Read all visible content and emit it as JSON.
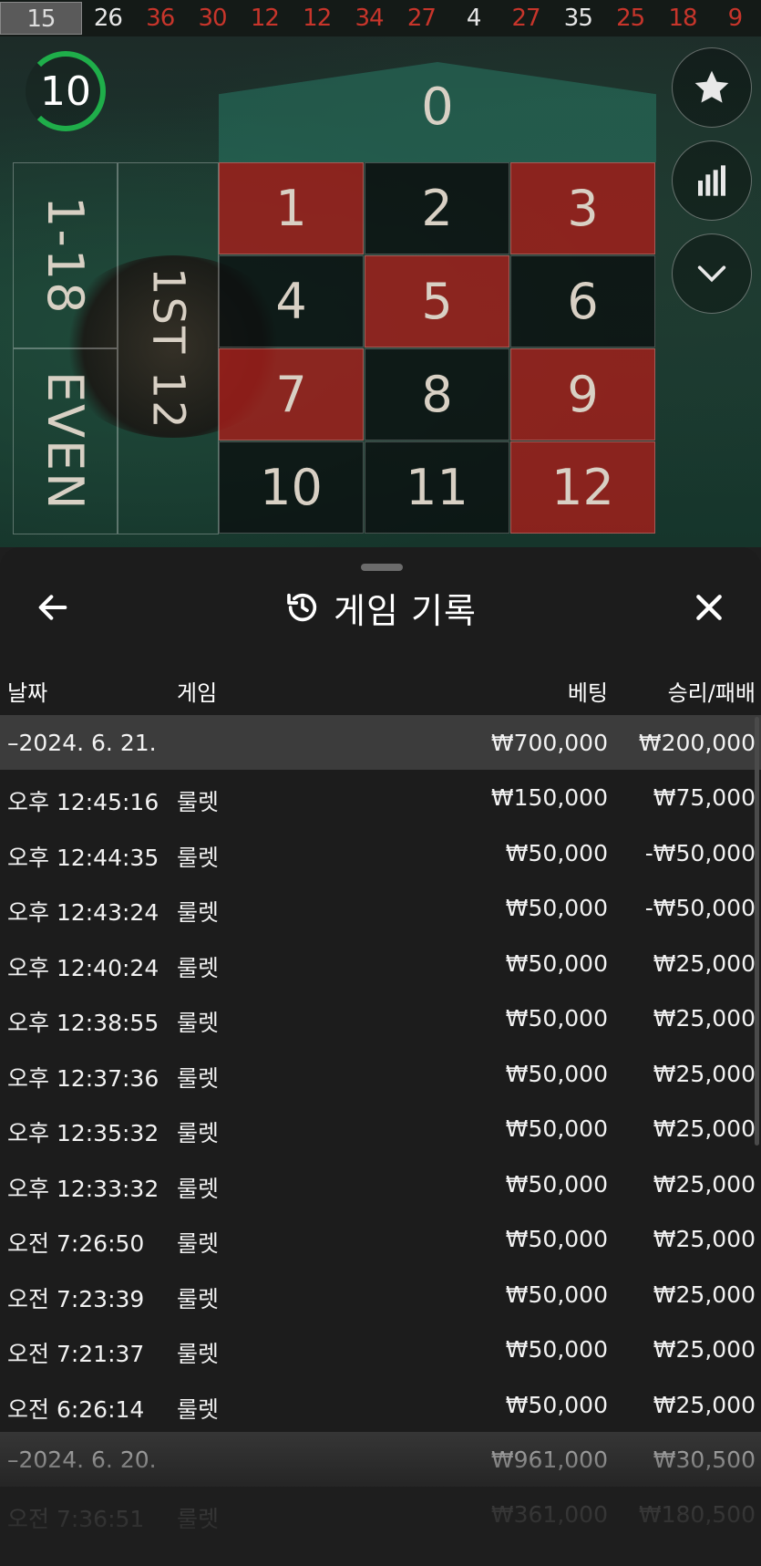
{
  "recent_results": [
    {
      "num": "15",
      "color": "latest"
    },
    {
      "num": "26",
      "color": "black"
    },
    {
      "num": "36",
      "color": "red"
    },
    {
      "num": "30",
      "color": "red"
    },
    {
      "num": "12",
      "color": "red"
    },
    {
      "num": "12",
      "color": "red"
    },
    {
      "num": "34",
      "color": "red"
    },
    {
      "num": "27",
      "color": "red"
    },
    {
      "num": "4",
      "color": "black"
    },
    {
      "num": "27",
      "color": "red"
    },
    {
      "num": "35",
      "color": "black"
    },
    {
      "num": "25",
      "color": "red"
    },
    {
      "num": "18",
      "color": "red"
    },
    {
      "num": "9",
      "color": "red"
    }
  ],
  "timer": "10",
  "board": {
    "zero": "0",
    "cells": [
      {
        "n": "1",
        "c": "red"
      },
      {
        "n": "2",
        "c": "black"
      },
      {
        "n": "3",
        "c": "red"
      },
      {
        "n": "4",
        "c": "black"
      },
      {
        "n": "5",
        "c": "red"
      },
      {
        "n": "6",
        "c": "black"
      },
      {
        "n": "7",
        "c": "red"
      },
      {
        "n": "8",
        "c": "black"
      },
      {
        "n": "9",
        "c": "red"
      },
      {
        "n": "10",
        "c": "black"
      },
      {
        "n": "11",
        "c": "black"
      },
      {
        "n": "12",
        "c": "red"
      }
    ],
    "outside_low": "1-18",
    "outside_even": "EVEN",
    "dozen_label": "1ST 12"
  },
  "side_buttons": [
    "star-icon",
    "stats-icon",
    "chevron-down-icon"
  ],
  "sheet": {
    "title": "게임 기록",
    "columns": {
      "date": "날짜",
      "game": "게임",
      "bet": "베팅",
      "result": "승리/패배"
    },
    "rows": [
      {
        "type": "group",
        "date": "–2024. 6. 21.",
        "game": "",
        "bet": "₩700,000",
        "result": "₩200,000"
      },
      {
        "type": "item",
        "date": "오후 12:45:16",
        "game": "룰렛",
        "bet": "₩150,000",
        "result": "₩75,000"
      },
      {
        "type": "item",
        "date": "오후 12:44:35",
        "game": "룰렛",
        "bet": "₩50,000",
        "result": "-₩50,000"
      },
      {
        "type": "item",
        "date": "오후 12:43:24",
        "game": "룰렛",
        "bet": "₩50,000",
        "result": "-₩50,000"
      },
      {
        "type": "item",
        "date": "오후 12:40:24",
        "game": "룰렛",
        "bet": "₩50,000",
        "result": "₩25,000"
      },
      {
        "type": "item",
        "date": "오후 12:38:55",
        "game": "룰렛",
        "bet": "₩50,000",
        "result": "₩25,000"
      },
      {
        "type": "item",
        "date": "오후 12:37:36",
        "game": "룰렛",
        "bet": "₩50,000",
        "result": "₩25,000"
      },
      {
        "type": "item",
        "date": "오후 12:35:32",
        "game": "룰렛",
        "bet": "₩50,000",
        "result": "₩25,000"
      },
      {
        "type": "item",
        "date": "오후 12:33:32",
        "game": "룰렛",
        "bet": "₩50,000",
        "result": "₩25,000"
      },
      {
        "type": "item",
        "date": "오전 7:26:50",
        "game": "룰렛",
        "bet": "₩50,000",
        "result": "₩25,000"
      },
      {
        "type": "item",
        "date": "오전 7:23:39",
        "game": "룰렛",
        "bet": "₩50,000",
        "result": "₩25,000"
      },
      {
        "type": "item",
        "date": "오전 7:21:37",
        "game": "룰렛",
        "bet": "₩50,000",
        "result": "₩25,000"
      },
      {
        "type": "item",
        "date": "오전 6:26:14",
        "game": "룰렛",
        "bet": "₩50,000",
        "result": "₩25,000"
      },
      {
        "type": "group",
        "date": "–2024. 6. 20.",
        "game": "",
        "bet": "₩961,000",
        "result": "₩30,500"
      },
      {
        "type": "item",
        "date": "오전 7:36:51",
        "game": "룰렛",
        "bet": "₩361,000",
        "result": "₩180,500"
      }
    ]
  }
}
